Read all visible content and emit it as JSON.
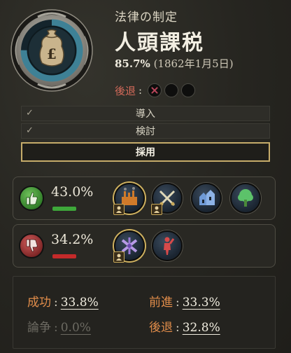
{
  "header": {
    "kicker": "法律の制定",
    "law_name": "人頭課税",
    "support_pct": "85.7%",
    "date": "(1862年1月5日)",
    "setbacks_label": "後退",
    "setbacks_colon": ":",
    "setbacks": [
      {
        "state": "failed"
      },
      {
        "state": "empty"
      },
      {
        "state": "empty"
      }
    ],
    "progress_fraction": 0.75
  },
  "stages": [
    {
      "check": "✓",
      "label": "導入",
      "completed": true
    },
    {
      "check": "✓",
      "label": "検討",
      "completed": true
    },
    {
      "check": "",
      "label": "採用",
      "completed": false,
      "current": true
    }
  ],
  "supporters": {
    "pct": "43.0%",
    "bar_color": "#3ea83a",
    "groups": [
      {
        "name": "industrialists-icon",
        "selected": true,
        "badge": true
      },
      {
        "name": "armed-forces-icon",
        "selected": false,
        "badge": true
      },
      {
        "name": "petite-bourgeoisie-icon",
        "selected": false,
        "badge": false
      },
      {
        "name": "rural-folk-icon",
        "selected": false,
        "badge": false
      }
    ]
  },
  "opposers": {
    "pct": "34.2%",
    "bar_color": "#c42a2a",
    "groups": [
      {
        "name": "landowners-icon",
        "selected": true,
        "badge": true
      },
      {
        "name": "trade-unions-icon",
        "selected": false,
        "badge": false
      }
    ]
  },
  "results": {
    "success_label": "成功",
    "success_value": "33.8%",
    "advance_label": "前進",
    "advance_value": "33.3%",
    "debate_label": "論争",
    "debate_value": "0.0%",
    "setback_label": "後退",
    "setback_value": "32.8%",
    "colon": ":"
  },
  "colors": {
    "accent_gold": "#c6ac6a",
    "orange_label": "#e08c4a",
    "setback_red": "#d46a5a"
  }
}
